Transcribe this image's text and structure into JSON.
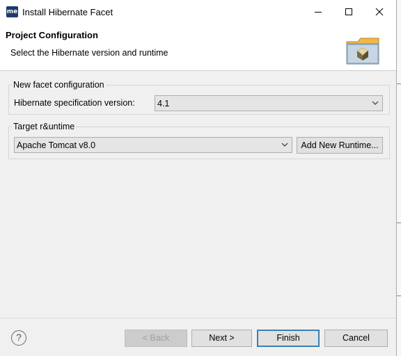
{
  "window": {
    "title": "Install Hibernate Facet",
    "app_icon_text": "me",
    "controls": [
      "minimize-icon",
      "maximize-icon",
      "close-icon"
    ]
  },
  "header": {
    "title": "Project Configuration",
    "description": "Select the Hibernate version and runtime",
    "banner_icon": "hibernate-folder-icon"
  },
  "facet_group": {
    "label": "New facet configuration",
    "spec_label": "Hibernate specification version:",
    "spec_value": "4.1"
  },
  "runtime_group": {
    "label": "Target r&untime",
    "runtime_value": "Apache Tomcat v8.0",
    "add_runtime_label": "Add New Runtime..."
  },
  "footer": {
    "help_icon": "help-icon",
    "help_glyph": "?",
    "back_label": "< Back",
    "next_label": "Next >",
    "finish_label": "Finish",
    "cancel_label": "Cancel"
  }
}
